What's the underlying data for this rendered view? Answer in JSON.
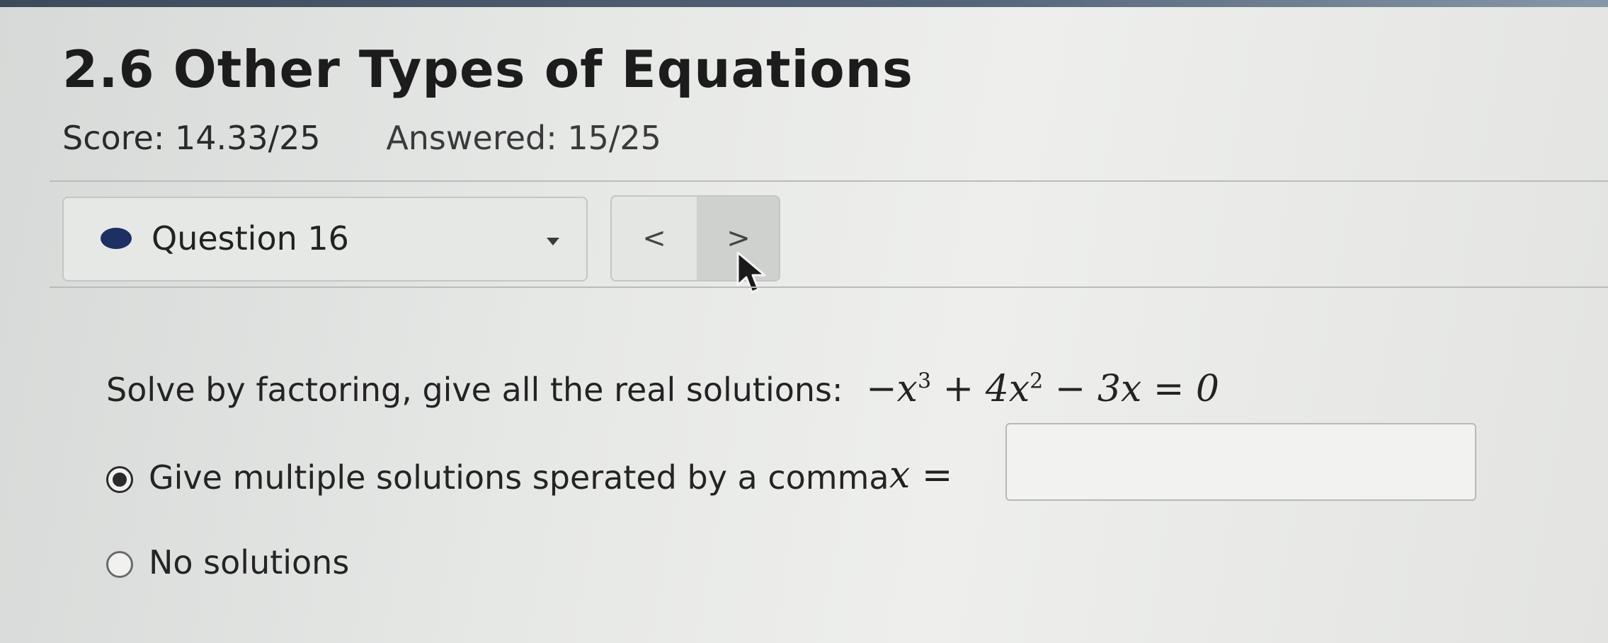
{
  "assignment": {
    "title": "2.6 Other Types of Equations",
    "score": "Score: 14.33/25",
    "answered": "Answered: 15/25"
  },
  "question_nav": {
    "current_label": "Question 16",
    "prev_glyph": "<",
    "next_glyph": ">"
  },
  "question": {
    "prompt": "Solve by factoring, give all the real solutions:",
    "equation": {
      "neg_x": "−x",
      "exp3": "3",
      "plus_4x": " + 4x",
      "exp2": "2",
      "rest": " − 3x = 0"
    }
  },
  "options": [
    {
      "label": "Give multiple solutions sperated by a comma",
      "selected": true
    },
    {
      "label": "No solutions",
      "selected": false
    }
  ],
  "answer_field": {
    "prefix": "x =",
    "value": "",
    "placeholder": ""
  },
  "colors": {
    "status_dot": "#1d2f63",
    "top_strip": "#3c4a5a"
  }
}
